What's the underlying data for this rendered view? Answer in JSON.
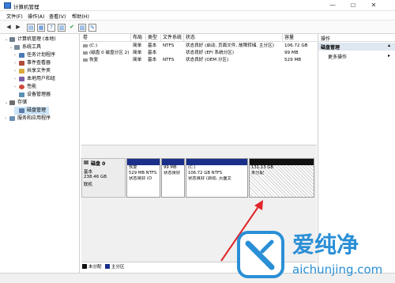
{
  "window": {
    "title": "计算机管理",
    "minimize": "—",
    "maximize": "☐",
    "close": "✕"
  },
  "menu": [
    "文件(F)",
    "操作(A)",
    "查看(V)",
    "帮助(H)"
  ],
  "toolbar": [
    "◀",
    "▶",
    "▤",
    "▦",
    "?",
    "▥",
    "✔",
    "▧",
    "✎"
  ],
  "tree": [
    {
      "exp": "⌄",
      "label": "计算机管理 (本地)",
      "color": "#6f7d8c"
    },
    {
      "exp": "⌄",
      "label": "系统工具",
      "color": "#7a8a9a"
    },
    {
      "exp": "›",
      "label": "任务计划程序",
      "color": "#4a78b6"
    },
    {
      "exp": "›",
      "label": "事件查看器",
      "color": "#b04a3a"
    },
    {
      "exp": "›",
      "label": "共享文件夹",
      "color": "#d8a93a"
    },
    {
      "exp": "›",
      "label": "本地用户和组",
      "color": "#7b5ea8"
    },
    {
      "exp": "›",
      "label": "性能",
      "color": "#cc4a3a"
    },
    {
      "exp": "",
      "label": "设备管理器",
      "color": "#5a8fb6"
    },
    {
      "exp": "⌄",
      "label": "存储",
      "color": "#6e6e6e"
    },
    {
      "exp": "",
      "label": "磁盘管理",
      "color": "#5b7da8"
    },
    {
      "exp": "›",
      "label": "服务和应用程序",
      "color": "#6b8fb4"
    }
  ],
  "list": {
    "headers": [
      "卷",
      "布局",
      "类型",
      "文件系统",
      "状态",
      "容量"
    ],
    "rows": [
      {
        "vol": "(C:)",
        "layout": "简单",
        "type": "基本",
        "fs": "NTFS",
        "status": "状态良好 (启动, 页面文件, 故障转储, 主分区)",
        "cap": "106.72 GB"
      },
      {
        "vol": "(磁盘 0 磁盘分区 2)",
        "layout": "简单",
        "type": "基本",
        "fs": "",
        "status": "状态良好 (EFI 系统分区)",
        "cap": "99 MB"
      },
      {
        "vol": "恢复",
        "layout": "简单",
        "type": "基本",
        "fs": "NTFS",
        "status": "状态良好 (OEM 分区)",
        "cap": "529 MB"
      }
    ]
  },
  "disk": {
    "name": "磁盘 0",
    "type": "基本",
    "size": "238.46 GB",
    "status": "联机",
    "partitions": [
      {
        "l1": "恢复",
        "l2": "529 MB NTFS",
        "l3": "状态良好 (O",
        "head": "#1a2f8a"
      },
      {
        "l1": "",
        "l2": "99 MB",
        "l3": "状态良好",
        "head": "#1a2f8a"
      },
      {
        "l1": "(C:)",
        "l2": "106.72 GB NTFS",
        "l3": "状态良好 (启动, 页面文",
        "head": "#1a2f8a"
      },
      {
        "l1": "",
        "l2": "131.13 GB",
        "l3": "未分配",
        "head": "#111111"
      }
    ]
  },
  "legend": [
    {
      "label": "未分配",
      "color": "#111111"
    },
    {
      "label": "主分区",
      "color": "#1a2f8a"
    }
  ],
  "actions": {
    "header": "操作",
    "selected": "磁盘管理",
    "more": "更多操作"
  },
  "watermark": {
    "brand": "爱纯净",
    "url": "aichunjing.com"
  },
  "colors": {
    "accent": "#1a2f8a",
    "arrow": "#e0262a",
    "actions_sel": "#dfe7f1"
  }
}
